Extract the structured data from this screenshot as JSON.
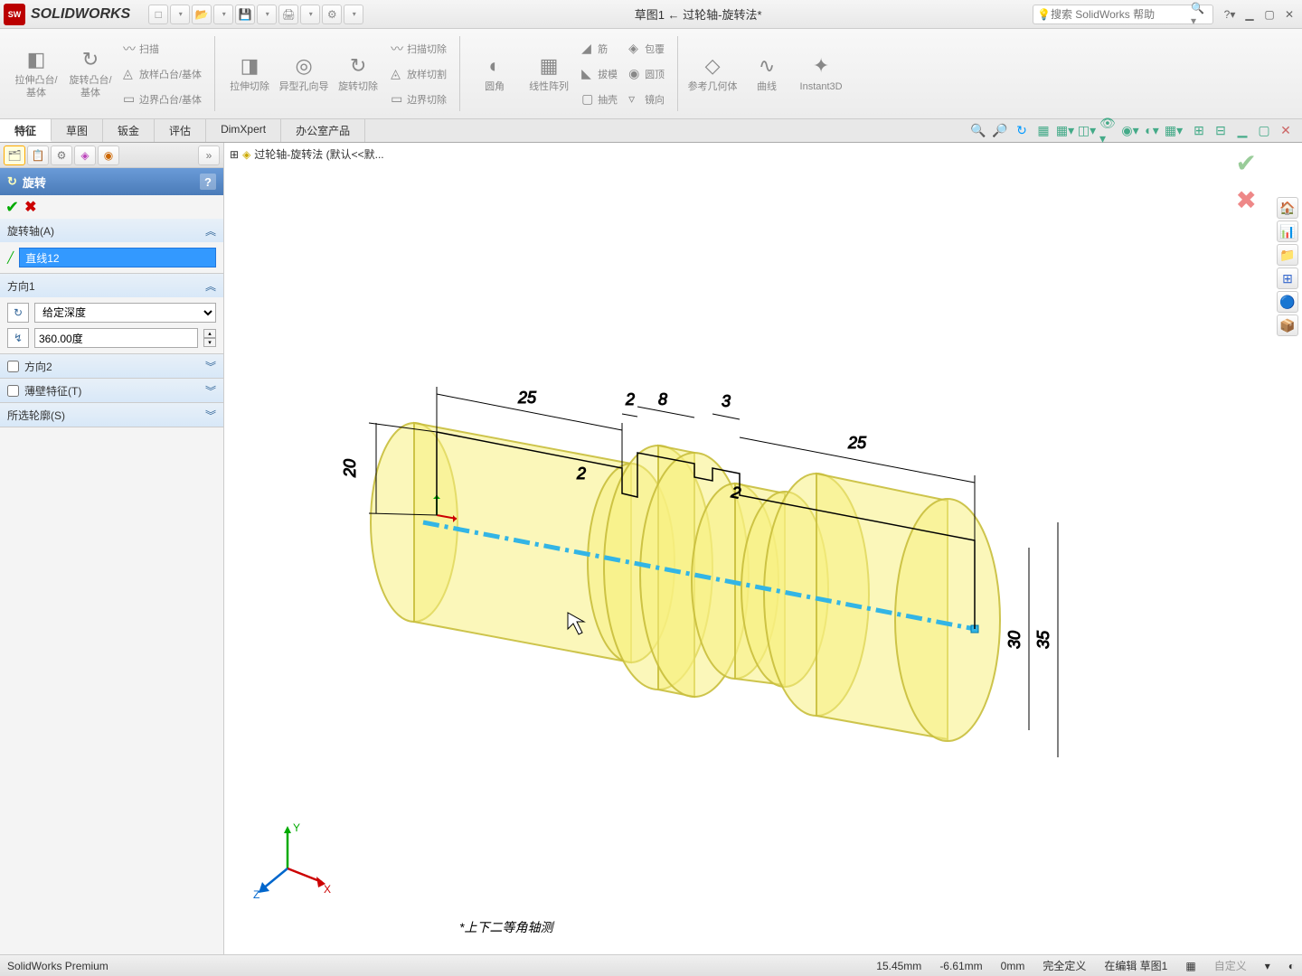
{
  "app": {
    "name": "SOLIDWORKS",
    "logo": "SW"
  },
  "document_title": "草图1 ← 过轮轴-旋转法*",
  "search": {
    "placeholder": "搜索 SolidWorks 帮助"
  },
  "qat": [
    "□",
    "⎌",
    "↻",
    "⋯",
    "📁",
    "💾",
    "🖨",
    "⚙",
    "⋯"
  ],
  "ribbon": {
    "groups": [
      {
        "large": [
          {
            "icon": "◧",
            "label": "拉伸凸台/基体"
          },
          {
            "icon": "↻",
            "label": "旋转凸台/基体"
          }
        ],
        "stack": [
          {
            "icon": "〰",
            "label": "扫描"
          },
          {
            "icon": "◬",
            "label": "放样凸台/基体"
          },
          {
            "icon": "▭",
            "label": "边界凸台/基体"
          }
        ]
      },
      {
        "large": [
          {
            "icon": "◨",
            "label": "拉伸切除"
          },
          {
            "icon": "◎",
            "label": "异型孔向导"
          },
          {
            "icon": "↻",
            "label": "旋转切除"
          }
        ],
        "stack": [
          {
            "icon": "〰",
            "label": "扫描切除"
          },
          {
            "icon": "◬",
            "label": "放样切割"
          },
          {
            "icon": "▭",
            "label": "边界切除"
          }
        ]
      },
      {
        "large": [
          {
            "icon": "◐",
            "label": "圆角"
          },
          {
            "icon": "▦",
            "label": "线性阵列"
          }
        ],
        "stack": [
          {
            "icon": "◢",
            "label": "筋"
          },
          {
            "icon": "◣",
            "label": "拔模"
          },
          {
            "icon": "▢",
            "label": "抽壳"
          }
        ],
        "stack2": [
          {
            "icon": "◈",
            "label": "包覆"
          },
          {
            "icon": "◉",
            "label": "圆顶"
          },
          {
            "icon": "▿",
            "label": "镜向"
          }
        ]
      },
      {
        "large": [
          {
            "icon": "◇",
            "label": "参考几何体"
          },
          {
            "icon": "∿",
            "label": "曲线"
          },
          {
            "icon": "✦",
            "label": "Instant3D"
          }
        ]
      }
    ]
  },
  "tabs": [
    "特征",
    "草图",
    "钣金",
    "评估",
    "DimXpert",
    "办公室产品"
  ],
  "active_tab": 0,
  "breadcrumb": "过轮轴-旋转法   (默认<<默...",
  "property_manager": {
    "title": "旋转",
    "sections": {
      "axis": {
        "title": "旋转轴(A)",
        "value": "直线12"
      },
      "direction1": {
        "title": "方向1",
        "type": "给定深度",
        "angle": "360.00度"
      },
      "direction2": {
        "title": "方向2",
        "checked": false
      },
      "thin": {
        "title": "薄壁特征(T)",
        "checked": false
      },
      "contours": {
        "title": "所选轮廓(S)"
      }
    }
  },
  "sketch": {
    "dimensions": {
      "d1": "25",
      "d2": "2",
      "d3": "8",
      "d4": "3",
      "d5": "25",
      "d6": "2",
      "d7": "2",
      "d8": "20",
      "d9": "30",
      "d10": "35"
    }
  },
  "view_label": "*上下二等角轴测",
  "statusbar": {
    "product": "SolidWorks Premium",
    "x": "15.45mm",
    "y": "-6.61mm",
    "z": "0mm",
    "state": "完全定义",
    "editing": "在编辑 草图1",
    "custom": "自定义"
  },
  "triad_labels": {
    "x": "X",
    "y": "Y",
    "z": "Z"
  }
}
